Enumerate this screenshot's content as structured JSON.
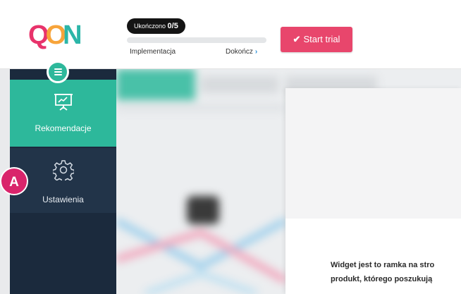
{
  "logo": {
    "letters": [
      "Q",
      "O",
      "N"
    ]
  },
  "onboarding": {
    "completed_prefix": "Ukończono",
    "completed_count": "0/5",
    "progress_fraction": 0,
    "step_label": "Implementacja",
    "finish_label": "Dokończ",
    "finish_icon": "chevron-right-icon"
  },
  "toolbar": {
    "trial_label": "Start trial",
    "trial_icon": "check-icon"
  },
  "sidebar": {
    "menu_icon": "hamburger-icon",
    "items": [
      {
        "label": "Rekomendacje",
        "icon": "presentation-board-icon",
        "active": true
      },
      {
        "label": "Ustawienia",
        "icon": "gear-icon",
        "active": false
      }
    ]
  },
  "annotation": {
    "badge": "A"
  },
  "panel": {
    "lines": [
      "Widget jest to ramka na stro",
      "produkt, którego poszukują"
    ]
  },
  "colors": {
    "accent_green": "#2db89b",
    "brand_pink": "#e8466c",
    "sidebar_dark": "#1b2a3d",
    "badge": "#d9246b"
  }
}
